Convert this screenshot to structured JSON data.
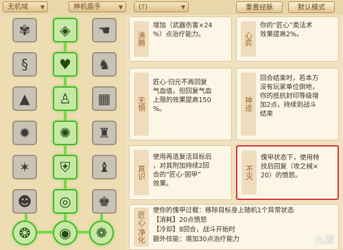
{
  "toolbar": {
    "dropdown1": "无机域",
    "dropdown2": "神机盾手",
    "dropdown3": "(?)",
    "reset_button": "重置经脉",
    "default_button": "默认模式"
  },
  "skill_tree": {
    "rows": [
      [
        "crest-icon",
        "gem-icon",
        "hand-icon"
      ],
      [
        "snake-icon",
        "heart-icon",
        "warrior-icon"
      ],
      [
        "mountain-icon",
        "runner-icon",
        "brick-wall-icon"
      ],
      [
        "burst-icon",
        "gear-icon",
        "figure-icon"
      ],
      [
        "star-icon",
        "shield-icon",
        "horn-icon"
      ],
      [
        "mask-icon",
        "spiral-icon",
        "armor-icon"
      ],
      [
        "ring-icon",
        "orb-icon",
        "beast-icon"
      ]
    ]
  },
  "cards": {
    "c1": {
      "tag": "沸腾",
      "lines": [
        "增加（武器伤害×24",
        "%）点治疗能力。"
      ]
    },
    "c2": {
      "tag": "心弈",
      "lines": [
        "你的“匠心”类法术",
        "效果提高2%。"
      ]
    },
    "c3": {
      "tag": "无惧",
      "lines": [
        "匠心·归元不再回复",
        "气血值，但回复气血",
        "上限的效果提高150",
        "%。"
      ]
    },
    "c4": {
      "tag": "神迹",
      "lines": [
        "回合结束时，若本方",
        "没有玩家单位倒地，",
        "你的抵抗封印等级增",
        "加2点，持续到战斗",
        "结束"
      ]
    },
    "c5": {
      "tag": "真识",
      "lines": [
        "使用再造复活目标后",
        "，对其附加持续2回",
        "合的“匠心·固甲”",
        "效果。"
      ]
    },
    "c6": {
      "tag": "不灭",
      "lines": [
        "傀甲状态下，使用特",
        "技后回复（攻之械×",
        "20）的愤怒。"
      ]
    },
    "c7": {
      "tag": "匠心·净化",
      "lines": [
        "使你的傀甲过载：移除目标身上随机1个异常状态",
        "【消耗】20点愤怒",
        "【冷却】8回合，战斗开始时",
        "额外技能：增加30点治疗能力"
      ]
    }
  },
  "watermark": "九游"
}
